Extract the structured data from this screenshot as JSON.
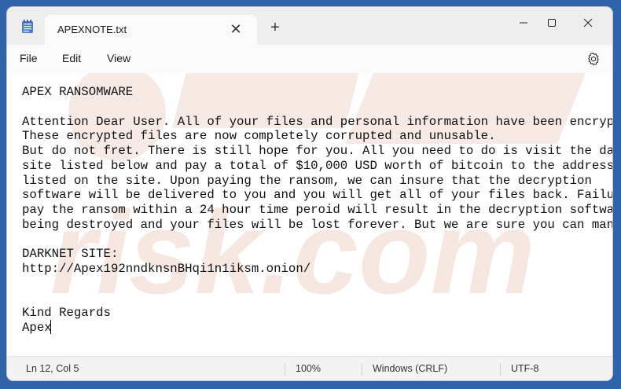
{
  "tab": {
    "title": "APEXNOTE.txt"
  },
  "menu": {
    "file": "File",
    "edit": "Edit",
    "view": "View"
  },
  "editor": {
    "content": "APEX RANSOMWARE\n\nAttention Dear User. All of your files and personal information have been encrypted.\nThese encrypted files are now completely corrupted and unusable.\nBut do not fret. There is still hope for you. All you need to do is visit the darknet\nsite listed below and pay a total of $10,000 USD worth of bitcoin to the address\nlisted on the site. Upon paying the ransom, we can insure that the decryption\nsoftware will be delivered to you and you will get all of your files back. Failure to\npay the ransom within a 24 hour time peroid will result in the decryption software\nbeing destroyed and your files will be lost forever. But we are sure you can manage.\n\nDARKNET SITE:\nhttp://Apex192nndknsnBHqi1n1iksm.onion/\n\n\nKind Regards\nApex"
  },
  "status": {
    "position": "Ln 12, Col 5",
    "zoom": "100%",
    "line_ending": "Windows (CRLF)",
    "encoding": "UTF-8"
  },
  "colors": {
    "desktop": "#2f64ab",
    "editor_bg": "#ffffff"
  }
}
